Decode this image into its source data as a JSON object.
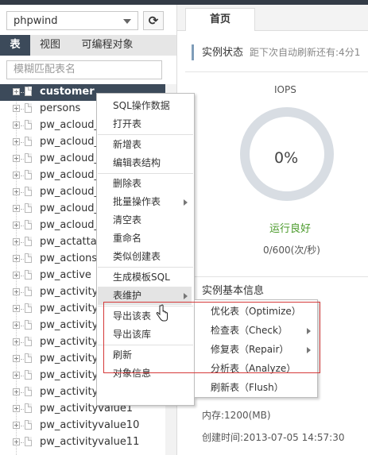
{
  "left_panel": {
    "db_select": {
      "value": "phpwind"
    },
    "refresh_icon": "refresh-icon",
    "tabs": [
      {
        "label": "表",
        "active": true
      },
      {
        "label": "视图",
        "active": false
      },
      {
        "label": "可编程对象",
        "active": false
      }
    ],
    "search": {
      "placeholder": "模糊匹配表名"
    },
    "tree_items": [
      {
        "name": "customer",
        "selected": true
      },
      {
        "name": "persons"
      },
      {
        "name": "pw_acloud_a"
      },
      {
        "name": "pw_acloud_a"
      },
      {
        "name": "pw_acloud_a"
      },
      {
        "name": "pw_acloud_e"
      },
      {
        "name": "pw_acloud_k"
      },
      {
        "name": "pw_acloud_s"
      },
      {
        "name": "pw_acloud_t"
      },
      {
        "name": "pw_actattach"
      },
      {
        "name": "pw_actions"
      },
      {
        "name": "pw_active"
      },
      {
        "name": "pw_activity"
      },
      {
        "name": "pw_activityca"
      },
      {
        "name": "pw_activityd"
      },
      {
        "name": "pw_activityfi"
      },
      {
        "name": "pw_activitym"
      },
      {
        "name": "pw_activitym"
      },
      {
        "name": "pw_activityp"
      },
      {
        "name": "pw_activityvalue1"
      },
      {
        "name": "pw_activityvalue10"
      },
      {
        "name": "pw_activityvalue11"
      }
    ]
  },
  "right_panel": {
    "tab_home": "首页",
    "instance_status": {
      "title": "实例状态",
      "subtitle": "距下次自动刷新还有:4分1"
    },
    "iops": {
      "label": "IOPS",
      "percent_text": "0%",
      "percent": 0,
      "status": "运行良好",
      "count": "0/600(次/秒)"
    },
    "basic_info": {
      "title": "实例基本信息"
    },
    "memory": "内存:1200(MB)",
    "created": "创建时间:2013-07-05 14:57:30"
  },
  "context_menu": {
    "items": [
      {
        "label": "SQL操作数据"
      },
      {
        "label": "打开表",
        "sep_after": true
      },
      {
        "label": "新增表"
      },
      {
        "label": "编辑表结构",
        "sep_after": true
      },
      {
        "label": "删除表"
      },
      {
        "label": "批量操作表",
        "submenu": true
      },
      {
        "label": "清空表"
      },
      {
        "label": "重命名"
      },
      {
        "label": "类似创建表",
        "sep_after": true
      },
      {
        "label": "生成模板SQL"
      },
      {
        "label": "表维护",
        "submenu": true,
        "hover": true,
        "sep_after": true
      },
      {
        "label": "导出该表"
      },
      {
        "label": "导出该库",
        "sep_after": true
      },
      {
        "label": "刷新"
      },
      {
        "label": "对象信息"
      }
    ]
  },
  "submenu": {
    "items": [
      {
        "label": "优化表（Optimize）"
      },
      {
        "label": "检查表（Check）",
        "submenu": true
      },
      {
        "label": "修复表（Repair）",
        "submenu": true
      },
      {
        "label": "分析表（Analyze）"
      },
      {
        "label": "刷新表（Flush）"
      }
    ]
  },
  "colors": {
    "dark": "#3c4a5a",
    "ok_green": "#4a9a2a",
    "highlight_red": "#d53a3a",
    "ring": "#d8dde3"
  }
}
